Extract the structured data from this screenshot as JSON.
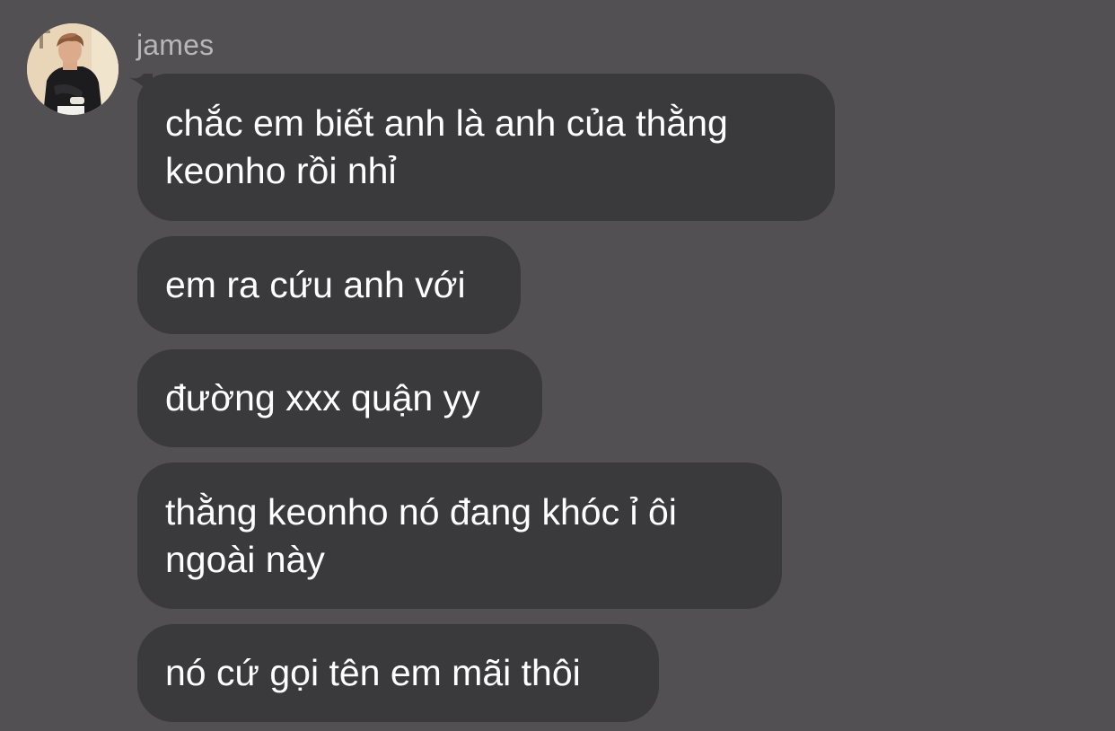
{
  "chat": {
    "sender": {
      "name": "james",
      "avatar_icon": "profile-photo"
    },
    "messages": [
      {
        "text": "chắc em biết anh là anh của thằng\nkeonho rồi nhỉ"
      },
      {
        "text": "em ra cứu anh với"
      },
      {
        "text": "đường xxx quận yy"
      },
      {
        "text": "thằng keonho nó đang khóc ỉ ôi\nngoài này"
      },
      {
        "text": "nó cứ gọi tên em mãi thôi"
      }
    ]
  },
  "colors": {
    "background": "#525053",
    "bubble": "#3a393c",
    "message_text": "#ffffff",
    "sender_text": "#b9b6ba"
  }
}
